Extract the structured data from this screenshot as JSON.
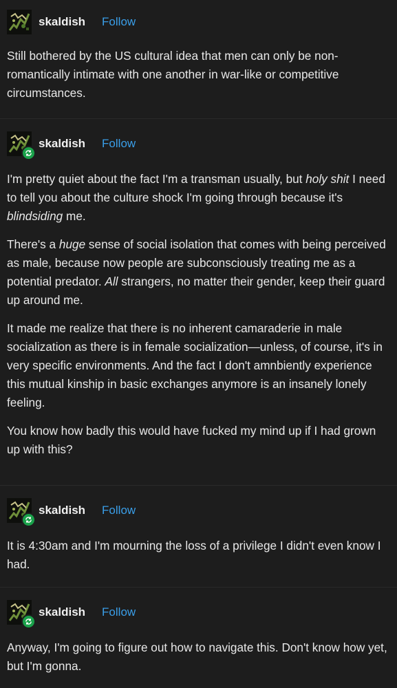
{
  "posts": [
    {
      "username": "skaldish",
      "follow_label": "Follow",
      "reblog_badge": false,
      "paragraphs": [
        [
          {
            "t": "Still bothered by the US cultural idea that men can only be non-romantically intimate with one another in war-like or competitive circumstances."
          }
        ]
      ]
    },
    {
      "username": "skaldish",
      "follow_label": "Follow",
      "reblog_badge": true,
      "paragraphs": [
        [
          {
            "t": "I'm pretty quiet about the fact I'm a transman usually, but "
          },
          {
            "t": "holy shit",
            "i": true
          },
          {
            "t": " I need to tell you about the culture shock I'm going through because it's "
          },
          {
            "t": "blindsiding",
            "i": true
          },
          {
            "t": " me."
          }
        ],
        [
          {
            "t": "There's a "
          },
          {
            "t": "huge",
            "i": true
          },
          {
            "t": " sense of social isolation that comes with being perceived as male, because now people are subconsciously treating me as a potential predator. "
          },
          {
            "t": "All",
            "i": true
          },
          {
            "t": " strangers, no matter their gender, keep their guard up around me."
          }
        ],
        [
          {
            "t": "It made me realize that there is no inherent camaraderie in male socialization as there is in female socialization—unless, of course, it's in very specific environments. And the fact I don't amnbiently experience this mutual kinship in basic exchanges anymore is an insanely lonely feeling."
          }
        ],
        [
          {
            "t": "You know how badly this would have fucked my mind up if I had grown up with this?"
          }
        ]
      ]
    },
    {
      "username": "skaldish",
      "follow_label": "Follow",
      "reblog_badge": true,
      "paragraphs": [
        [
          {
            "t": "It is 4:30am and I'm mourning the loss of a privilege I didn't even know I had."
          }
        ]
      ]
    },
    {
      "username": "skaldish",
      "follow_label": "Follow",
      "reblog_badge": true,
      "paragraphs": [
        [
          {
            "t": "Anyway, I'm going to figure out how to navigate this. Don't know how yet, but I'm gonna."
          }
        ]
      ]
    }
  ],
  "colors": {
    "background": "#1d1d1d",
    "text": "#e8e8e8",
    "follow": "#3a9ee8",
    "reblog_badge": "#1aa14a",
    "divider": "#2a2a2a"
  },
  "icons": {
    "avatar": "avatar-image",
    "reblog": "reblog-icon"
  }
}
